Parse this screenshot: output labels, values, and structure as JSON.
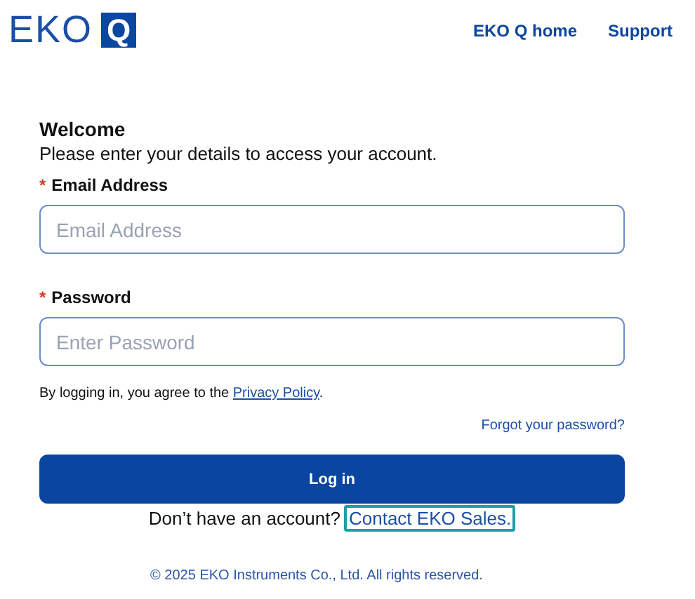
{
  "header": {
    "logo": {
      "text": "EKO",
      "mark": "Q"
    },
    "nav": [
      {
        "label": "EKO Q home"
      },
      {
        "label": "Support"
      }
    ]
  },
  "form": {
    "title": "Welcome",
    "subtitle": "Please enter your details to access your account.",
    "fields": [
      {
        "label": "Email Address",
        "required": true,
        "placeholder": "Email Address"
      },
      {
        "label": "Password",
        "required": true,
        "placeholder": "Enter Password"
      }
    ],
    "required_mark": "*",
    "consent": {
      "text": "By logging in, you agree to the ",
      "link": "Privacy Policy",
      "end": "."
    },
    "forgot_link": "Forgot your password?",
    "submit": "Log in",
    "signup": {
      "text": "Don’t have an account?",
      "link": "Contact EKO Sales.",
      "focused": true
    }
  },
  "footer": "© 2025 EKO Instruments Co., Ltd. All rights reserved."
}
